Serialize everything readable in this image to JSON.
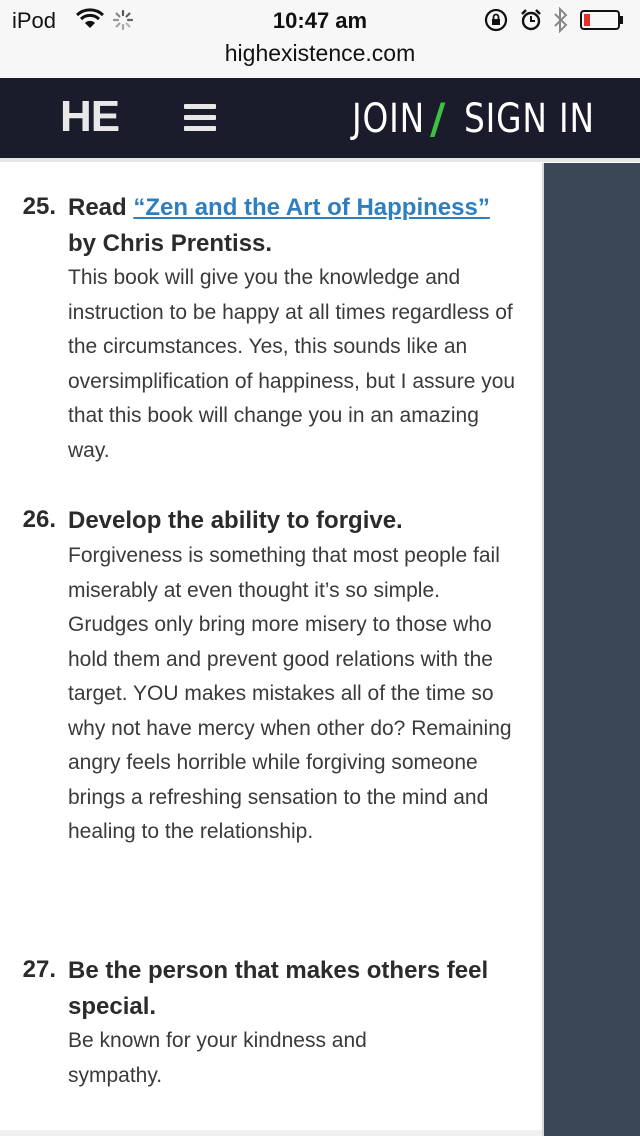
{
  "status_bar": {
    "carrier": "iPod",
    "time": "10:47 am"
  },
  "browser": {
    "url": "highexistence.com",
    "load_progress": 0.4
  },
  "site_header": {
    "logo": "HE",
    "join_label": "JOIN",
    "separator": "/",
    "signin_label": "SIGN IN"
  },
  "article": {
    "items": [
      {
        "number": "25.",
        "title_prefix": "Read ",
        "title_link": "“Zen and the Art of Happiness”",
        "title_suffix": " by Chris Prentiss.",
        "body": "This book will give you the knowledge and instruction to be happy at all times regardless of the circumstances. Yes, this sounds like an oversimplification of happiness, but I assure you that this book will change you in an amazing way."
      },
      {
        "number": "26.",
        "title": "Develop the ability to forgive.",
        "body": "Forgiveness is something that most people fail miserably at even thought it’s so simple. Grudges only bring more misery to those who hold them and prevent good relations with the target. YOU makes mistakes all of the time so why not have mercy when other do? Remaining angry feels horrible while forgiving someone brings a refreshing sensation to the mind and healing to the relationship."
      },
      {
        "number": "27.",
        "title": "Be the person that makes others feel special.",
        "body": "Be known for your kindness and sympathy."
      }
    ]
  },
  "colors": {
    "header_bg": "#1a1b2b",
    "accent_green": "#3cc242",
    "link_blue": "#2f7fbf",
    "sidebar_bg": "#3b4657",
    "progress_blue": "#2d7fd9"
  }
}
